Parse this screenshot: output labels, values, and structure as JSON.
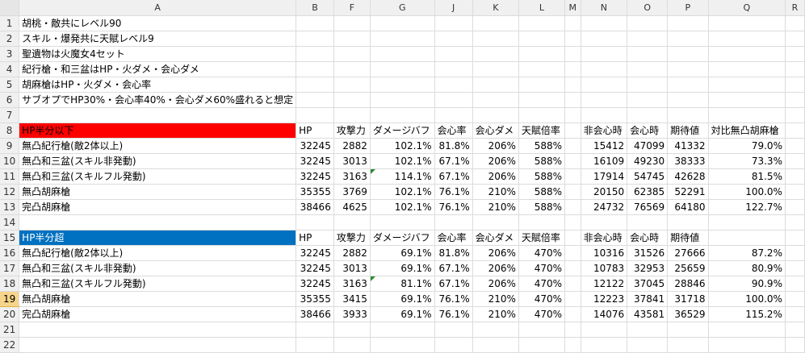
{
  "columns": [
    "",
    "A",
    "B",
    "F",
    "G",
    "J",
    "K",
    "L",
    "M",
    "N",
    "O",
    "P",
    "Q",
    "R"
  ],
  "notes": [
    "胡桃・敵共にレベル90",
    "スキル・爆発共に天賦レベル9",
    "聖遺物は火魔女4セット",
    "紀行槍・和三盆はHP・火ダメ・会心ダメ",
    "胡麻槍はHP・火ダメ・会心率",
    "サブオプでHP30%・会心率40%・会心ダメ60%盛れると想定"
  ],
  "table1": {
    "section_label": "HP半分以下",
    "headers": [
      "HP",
      "攻撃力",
      "ダメージバフ",
      "会心率",
      "会心ダメ",
      "天賦倍率",
      "",
      "非会心時",
      "会心時",
      "期待値",
      "対比無凸胡麻槍"
    ],
    "rows": [
      {
        "name": "無凸紀行槍(敵2体以上)",
        "cells": [
          "32245",
          "2882",
          "102.1%",
          "81.8%",
          "206%",
          "588%",
          "",
          "15412",
          "47099",
          "41332",
          "79.0%"
        ]
      },
      {
        "name": "無凸和三盆(スキル非発動)",
        "cells": [
          "32245",
          "3013",
          "102.1%",
          "67.1%",
          "206%",
          "588%",
          "",
          "16109",
          "49230",
          "38333",
          "73.3%"
        ]
      },
      {
        "name": "無凸和三盆(スキルフル発動)",
        "cells": [
          "32245",
          "3163",
          "114.1%",
          "67.1%",
          "206%",
          "588%",
          "",
          "17914",
          "54745",
          "42628",
          "81.5%"
        ]
      },
      {
        "name": "無凸胡麻槍",
        "cells": [
          "35355",
          "3769",
          "102.1%",
          "76.1%",
          "210%",
          "588%",
          "",
          "20150",
          "62385",
          "52291",
          "100.0%"
        ]
      },
      {
        "name": "完凸胡麻槍",
        "cells": [
          "38466",
          "4625",
          "102.1%",
          "76.1%",
          "210%",
          "588%",
          "",
          "24732",
          "76569",
          "64180",
          "122.7%"
        ]
      }
    ]
  },
  "table2": {
    "section_label": "HP半分超",
    "headers": [
      "HP",
      "攻撃力",
      "ダメージバフ",
      "会心率",
      "会心ダメ",
      "天賦倍率",
      "",
      "非会心時",
      "会心時",
      "期待値",
      ""
    ],
    "rows": [
      {
        "name": "無凸紀行槍(敵2体以上)",
        "cells": [
          "32245",
          "2882",
          "69.1%",
          "81.8%",
          "206%",
          "470%",
          "",
          "10316",
          "31526",
          "27666",
          "87.2%"
        ]
      },
      {
        "name": "無凸和三盆(スキル非発動)",
        "cells": [
          "32245",
          "3013",
          "69.1%",
          "67.1%",
          "206%",
          "470%",
          "",
          "10783",
          "32953",
          "25659",
          "80.9%"
        ]
      },
      {
        "name": "無凸和三盆(スキルフル発動)",
        "cells": [
          "32245",
          "3163",
          "81.1%",
          "67.1%",
          "206%",
          "470%",
          "",
          "12122",
          "37045",
          "28846",
          "90.9%"
        ]
      },
      {
        "name": "無凸胡麻槍",
        "cells": [
          "35355",
          "3415",
          "69.1%",
          "76.1%",
          "210%",
          "470%",
          "",
          "12223",
          "37841",
          "31718",
          "100.0%"
        ]
      },
      {
        "name": "完凸胡麻槍",
        "cells": [
          "38466",
          "3933",
          "69.1%",
          "76.1%",
          "210%",
          "470%",
          "",
          "14076",
          "43581",
          "36529",
          "115.2%"
        ]
      }
    ]
  },
  "selected_row": "19",
  "row_numbers": [
    "1",
    "2",
    "3",
    "4",
    "5",
    "6",
    "7",
    "8",
    "9",
    "10",
    "11",
    "12",
    "13",
    "14",
    "15",
    "16",
    "17",
    "18",
    "19",
    "20",
    "21",
    "22"
  ]
}
